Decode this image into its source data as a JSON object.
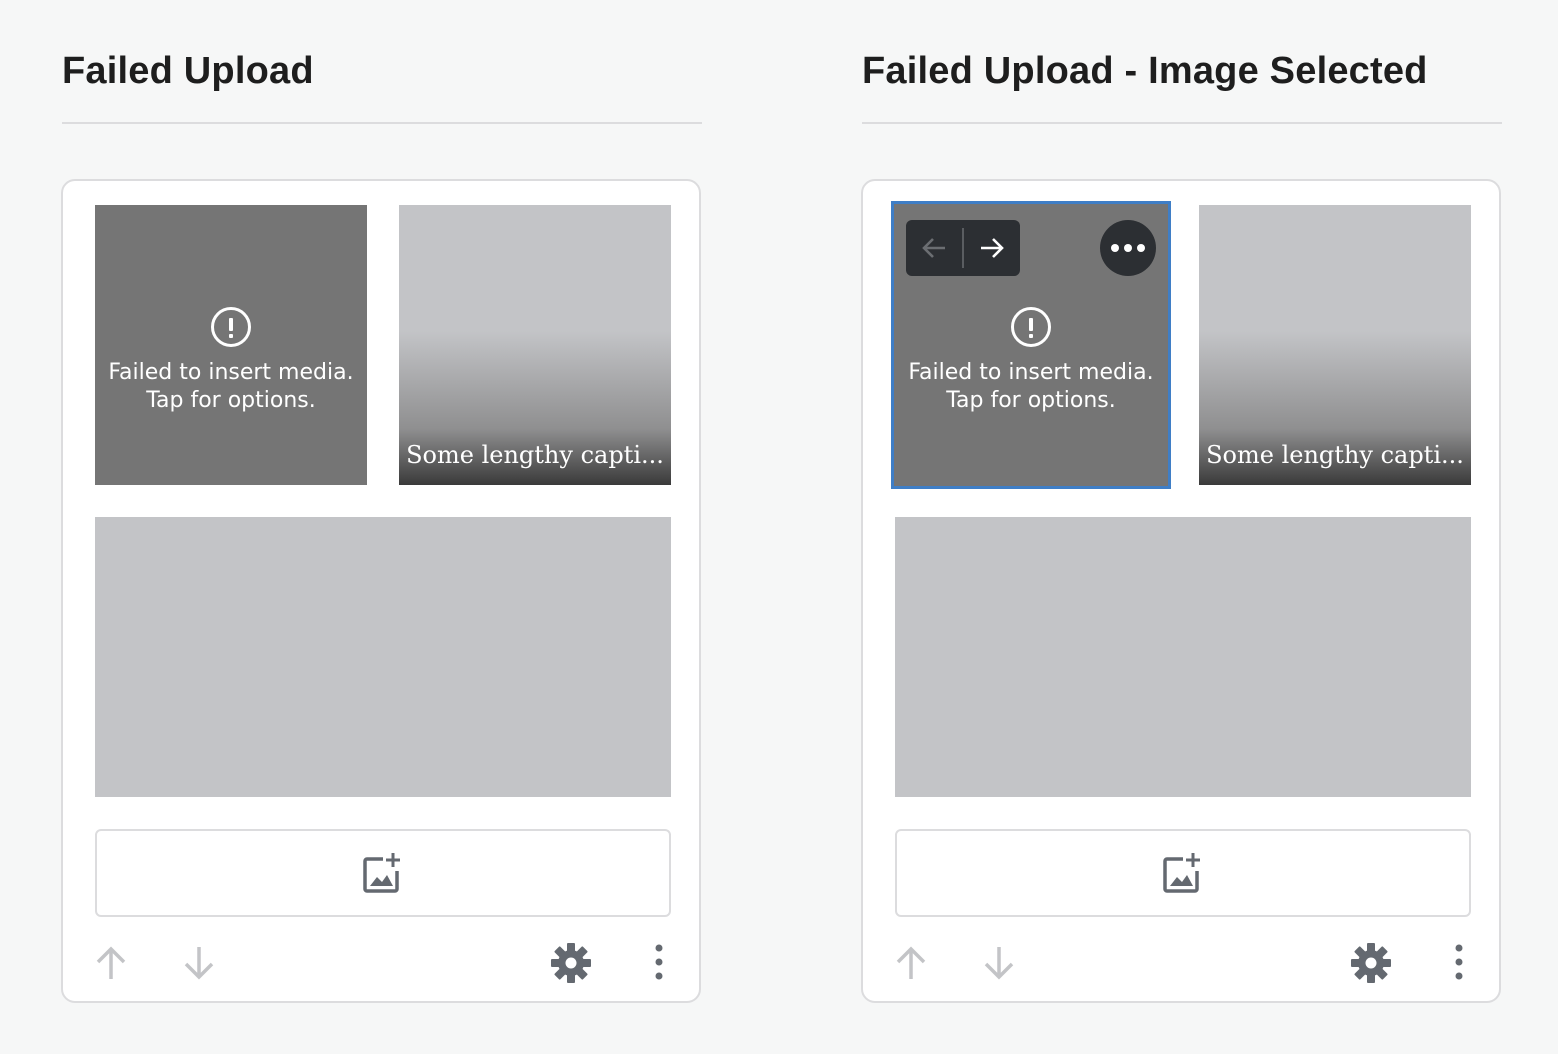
{
  "left": {
    "title": "Failed Upload",
    "failed_line1": "Failed to insert media.",
    "failed_line2": "Tap for options.",
    "caption": "Some lengthy capti..."
  },
  "right": {
    "title": "Failed Upload - Image Selected",
    "failed_line1": "Failed to insert media.",
    "failed_line2": "Tap for options.",
    "caption": "Some lengthy capti..."
  },
  "colors": {
    "background": "#f6f7f7",
    "failed_tile": "#757575",
    "placeholder_tile": "#c3c4c7",
    "selection_border": "#3f7ec6",
    "dark_control": "#2c2f33",
    "icon_gray": "#646970",
    "disabled_arrow": "#c3c4c7"
  },
  "icons": {
    "alert": "alert-circle-icon",
    "add_media": "image-plus-icon",
    "move_up": "arrow-up-icon",
    "move_down": "arrow-down-icon",
    "settings": "gear-icon",
    "more": "vertical-ellipsis-icon",
    "move_left": "arrow-left-icon",
    "move_right": "arrow-right-icon",
    "more_horizontal": "horizontal-ellipsis-icon"
  }
}
